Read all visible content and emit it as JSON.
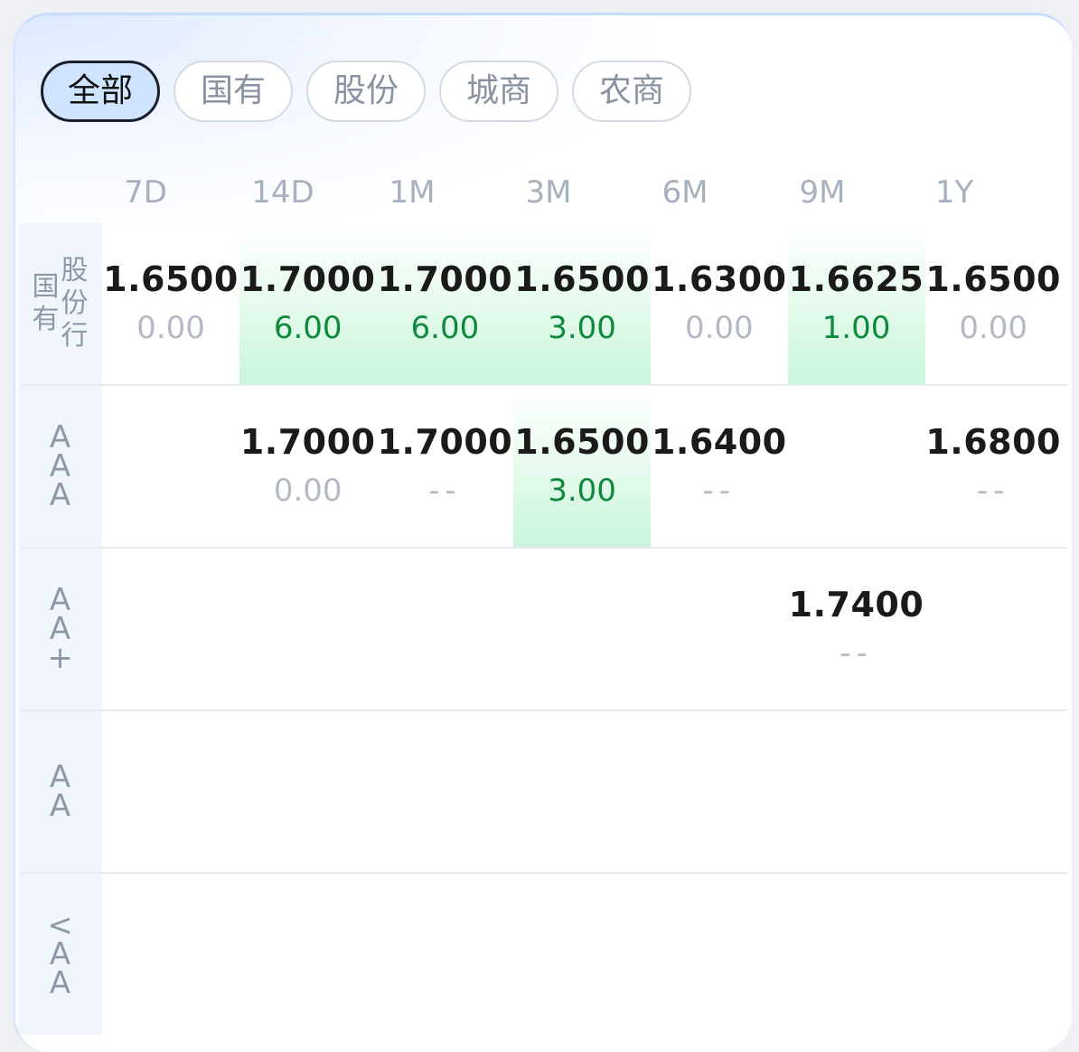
{
  "tabs": [
    "全部",
    "国有",
    "股份",
    "城商",
    "农商"
  ],
  "active_tab": "全部",
  "columns": [
    "7D",
    "14D",
    "1M",
    "3M",
    "6M",
    "9M",
    "1Y"
  ],
  "rows": [
    {
      "label_col1": [
        "国",
        "有"
      ],
      "label_col2": [
        "股",
        "份",
        "行"
      ],
      "cells": [
        {
          "rate": "1.6500",
          "change": "0.00",
          "tone": "flat"
        },
        {
          "rate": "1.7000",
          "change": "6.00",
          "tone": "up"
        },
        {
          "rate": "1.7000",
          "change": "6.00",
          "tone": "up"
        },
        {
          "rate": "1.6500",
          "change": "3.00",
          "tone": "up"
        },
        {
          "rate": "1.6300",
          "change": "0.00",
          "tone": "flat"
        },
        {
          "rate": "1.6625",
          "change": "1.00",
          "tone": "up"
        },
        {
          "rate": "1.6500",
          "change": "0.00",
          "tone": "flat"
        }
      ]
    },
    {
      "label_chars": [
        "A",
        "A",
        "A"
      ],
      "cells": [
        null,
        {
          "rate": "1.7000",
          "change": "0.00",
          "tone": "flat"
        },
        {
          "rate": "1.7000",
          "change": "--",
          "tone": "dash"
        },
        {
          "rate": "1.6500",
          "change": "3.00",
          "tone": "up"
        },
        {
          "rate": "1.6400",
          "change": "--",
          "tone": "dash"
        },
        null,
        {
          "rate": "1.6800",
          "change": "--",
          "tone": "dash"
        }
      ]
    },
    {
      "label_chars": [
        "A",
        "A",
        "+"
      ],
      "cells": [
        null,
        null,
        null,
        null,
        null,
        {
          "rate": "1.7400",
          "change": "--",
          "tone": "dash"
        },
        null
      ]
    },
    {
      "label_chars": [
        "A",
        "A"
      ],
      "cells": [
        null,
        null,
        null,
        null,
        null,
        null,
        null
      ]
    },
    {
      "label_chars": [
        "<",
        "A",
        "A"
      ],
      "cells": [
        null,
        null,
        null,
        null,
        null,
        null,
        null
      ]
    }
  ],
  "colors": {
    "up": "#0f8a3c",
    "flat": "#b3bac6",
    "highlight": "#c9f6dc",
    "active_tab_bg": "#cfe5ff"
  }
}
